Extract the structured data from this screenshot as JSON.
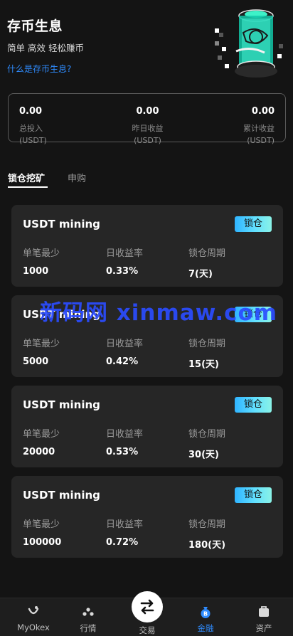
{
  "header": {
    "title": "存币生息",
    "subtitle": "简单 高效 轻松赚币",
    "help_link": "什么是存币生息?"
  },
  "summary": [
    {
      "value": "0.00",
      "label": "总投入",
      "unit": "(USDT)"
    },
    {
      "value": "0.00",
      "label": "昨日收益",
      "unit": "(USDT)"
    },
    {
      "value": "0.00",
      "label": "累计收益",
      "unit": "(USDT)"
    }
  ],
  "tabs": [
    {
      "label": "锁仓挖矿",
      "active": true
    },
    {
      "label": "申购",
      "active": false
    }
  ],
  "metric_labels": {
    "min": "单笔最少",
    "rate": "日收益率",
    "period": "锁仓周期"
  },
  "products": [
    {
      "title": "USDT mining",
      "button": "锁仓",
      "min": "1000",
      "rate": "0.33%",
      "period": "7(天)"
    },
    {
      "title": "USDT mining",
      "button": "锁仓",
      "min": "5000",
      "rate": "0.42%",
      "period": "15(天)"
    },
    {
      "title": "USDT mining",
      "button": "锁仓",
      "min": "20000",
      "rate": "0.53%",
      "period": "30(天)"
    },
    {
      "title": "USDT mining",
      "button": "锁仓",
      "min": "100000",
      "rate": "0.72%",
      "period": "180(天)"
    }
  ],
  "watermark": "新码网 xinmaw.com",
  "bottom_nav": [
    {
      "label": "MyOkex",
      "icon": "okex-logo-icon"
    },
    {
      "label": "行情",
      "icon": "market-icon"
    },
    {
      "label": "交易",
      "icon": "swap-arrows-icon"
    },
    {
      "label": "金融",
      "icon": "money-bag-icon",
      "active": true
    },
    {
      "label": "资产",
      "icon": "wallet-icon"
    }
  ],
  "colors": {
    "background": "#141414",
    "card": "#262626",
    "accent_blue": "#2f8cff",
    "button_gradient_start": "#2fb4ff",
    "button_gradient_end": "#8af2e6"
  }
}
